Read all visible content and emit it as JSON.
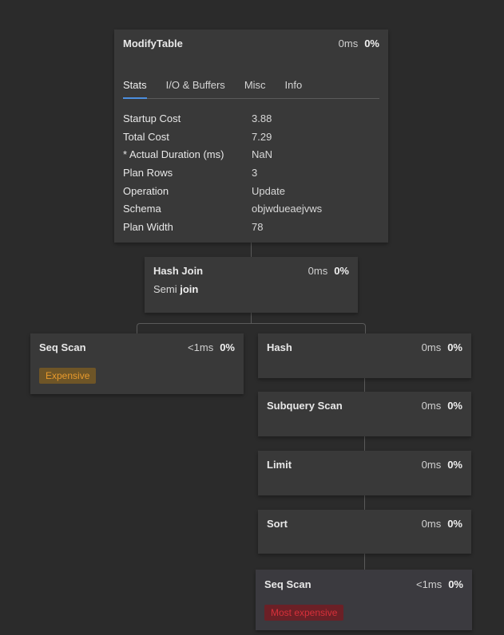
{
  "modify_table": {
    "title": "ModifyTable",
    "time": "0ms",
    "percent": "0%",
    "tabs": [
      "Stats",
      "I/O & Buffers",
      "Misc",
      "Info"
    ],
    "active_tab": "Stats",
    "stats": [
      {
        "key": "Startup Cost",
        "value": "3.88"
      },
      {
        "key": "Total Cost",
        "value": "7.29"
      },
      {
        "key": "* Actual Duration (ms)",
        "value": "NaN"
      },
      {
        "key": "Plan Rows",
        "value": "3"
      },
      {
        "key": "Operation",
        "value": "Update"
      },
      {
        "key": "Schema",
        "value": "objwdueaejvws"
      },
      {
        "key": "Plan Width",
        "value": "78"
      }
    ]
  },
  "hash_join": {
    "title": "Hash Join",
    "time": "0ms",
    "percent": "0%",
    "subtitle_prefix": "Semi",
    "subtitle_bold": "join"
  },
  "seq_scan_left": {
    "title": "Seq Scan",
    "time": "<1ms",
    "percent": "0%",
    "badge": "Expensive"
  },
  "hash": {
    "title": "Hash",
    "time": "0ms",
    "percent": "0%"
  },
  "subquery_scan": {
    "title": "Subquery Scan",
    "time": "0ms",
    "percent": "0%"
  },
  "limit": {
    "title": "Limit",
    "time": "0ms",
    "percent": "0%"
  },
  "sort": {
    "title": "Sort",
    "time": "0ms",
    "percent": "0%"
  },
  "seq_scan_bottom": {
    "title": "Seq Scan",
    "time": "<1ms",
    "percent": "0%",
    "badge": "Most expensive"
  },
  "colors": {
    "background": "#2b2b2b",
    "node": "#393939",
    "accent_tab": "#4c8fe0",
    "expensive": "#e89a2c",
    "most_expensive": "#d6303a"
  }
}
